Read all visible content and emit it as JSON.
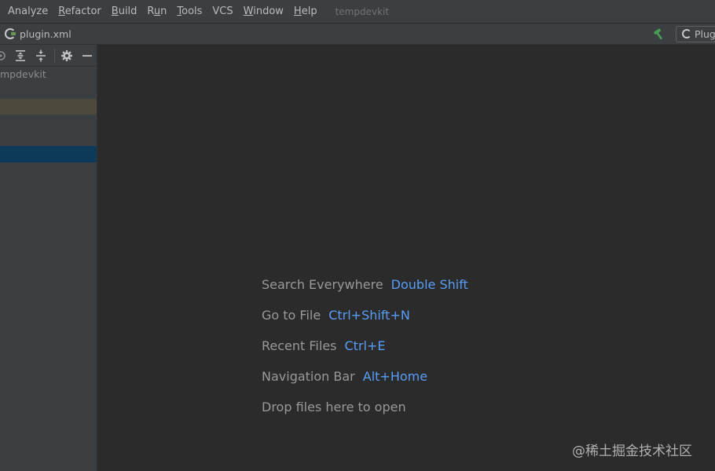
{
  "menu": {
    "items": [
      {
        "pre": "Analyze",
        "mn": "",
        "post": ""
      },
      {
        "pre": "",
        "mn": "R",
        "post": "efactor"
      },
      {
        "pre": "",
        "mn": "B",
        "post": "uild"
      },
      {
        "pre": "R",
        "mn": "u",
        "post": "n"
      },
      {
        "pre": "",
        "mn": "T",
        "post": "ools"
      },
      {
        "pre": "VCS",
        "mn": "",
        "post": ""
      },
      {
        "pre": "",
        "mn": "W",
        "post": "indow"
      },
      {
        "pre": "",
        "mn": "H",
        "post": "elp"
      }
    ],
    "project_name": "tempdevkit"
  },
  "navbar": {
    "file_label": "plugin.xml",
    "run_config_label": "Plug"
  },
  "project_panel": {
    "root_label": "mpdevkit"
  },
  "editor": {
    "hints": [
      {
        "label": "Search Everywhere",
        "shortcut": "Double Shift"
      },
      {
        "label": "Go to File",
        "shortcut": "Ctrl+Shift+N"
      },
      {
        "label": "Recent Files",
        "shortcut": "Ctrl+E"
      },
      {
        "label": "Navigation Bar",
        "shortcut": "Alt+Home"
      },
      {
        "label": "Drop files here to open",
        "shortcut": ""
      }
    ]
  },
  "watermark": "@稀土掘金技术社区",
  "colors": {
    "background": "#2b2b2b",
    "panel": "#3c3f41",
    "shortcut_accent": "#589df6",
    "selection": "#0d3a58"
  }
}
